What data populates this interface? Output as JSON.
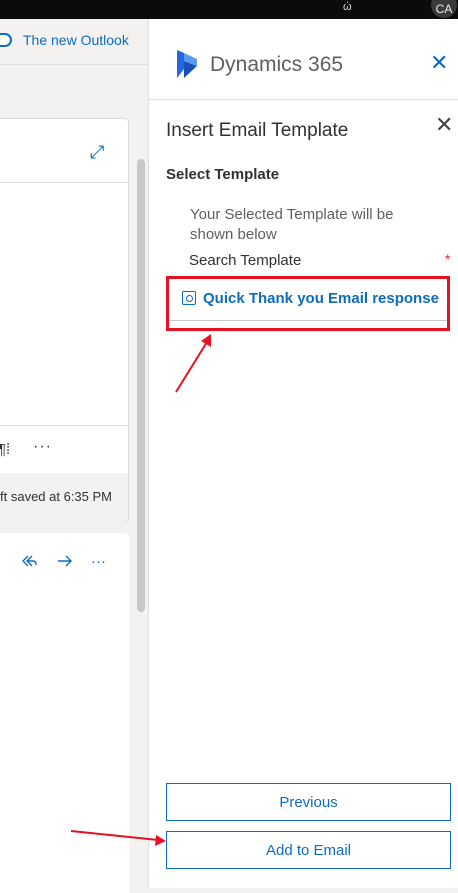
{
  "topbar": {
    "avatar_initials": "CA"
  },
  "outlook": {
    "new_outlook_label": "The new Outlook",
    "draft_status": "ft saved at 6:35 PM",
    "more_label": "···",
    "card2_more_label": "···"
  },
  "panel": {
    "brand": "Dynamics 365",
    "title": "Insert Email Template",
    "select_template_label": "Select Template",
    "info_text": "Your Selected Template will be shown below",
    "search_label": "Search Template",
    "required_marker": "*",
    "selected_template": "Quick Thank you Email response",
    "buttons": {
      "previous": "Previous",
      "add_to_email": "Add to Email"
    }
  },
  "colors": {
    "accent": "#0f6cbd",
    "annotation": "#e81123",
    "dynamics_logo": "#2266e3"
  },
  "icons": [
    "expand-icon",
    "paragraph-icon",
    "reply-all-icon",
    "forward-icon",
    "close-icon",
    "template-icon",
    "dynamics-logo"
  ]
}
